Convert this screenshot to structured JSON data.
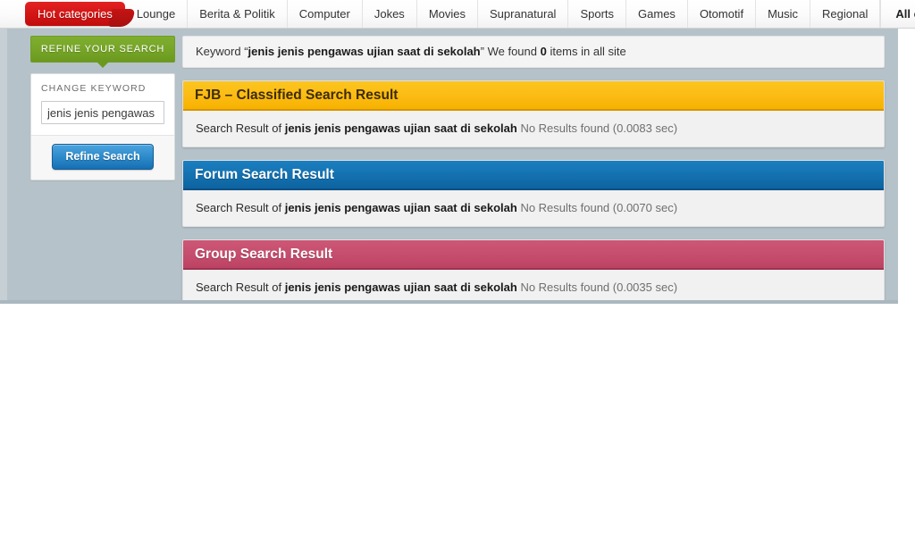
{
  "nav": {
    "hot_tab": "Hot categories",
    "items": [
      "Lounge",
      "Berita & Politik",
      "Computer",
      "Jokes",
      "Movies",
      "Supranatural",
      "Sports",
      "Games",
      "Otomotif",
      "Music",
      "Regional"
    ],
    "all_categories": "All categories"
  },
  "sidebar": {
    "refine_banner": "REFINE YOUR SEARCH",
    "change_keyword_label": "CHANGE KEYWORD",
    "keyword_value": "jenis jenis pengawas ujian saat di sekolah",
    "keyword_placeholder": "",
    "refine_button": "Refine Search"
  },
  "keyword_bar": {
    "prefix": "Keyword “",
    "keyword": "jenis jenis pengawas ujian saat di sekolah",
    "middle": "” We found ",
    "count": "0",
    "suffix": " items in all site"
  },
  "panels": [
    {
      "title": "FJB – Classified Search Result",
      "body_prefix": "Search Result of ",
      "keyword": "jenis jenis pengawas ujian saat di sekolah",
      "body_suffix": "  No Results found (0.0083 sec)",
      "color": "#fbb913"
    },
    {
      "title": "Forum Search Result",
      "body_prefix": "Search Result of ",
      "keyword": "jenis jenis pengawas ujian saat di sekolah",
      "body_suffix": " No Results found (0.0070 sec)",
      "color": "#136fae"
    },
    {
      "title": "Group Search Result",
      "body_prefix": "Search Result of ",
      "keyword": "jenis jenis pengawas ujian saat di sekolah",
      "body_suffix": " No Results found (0.0035 sec)",
      "color": "#c44c6c"
    }
  ]
}
